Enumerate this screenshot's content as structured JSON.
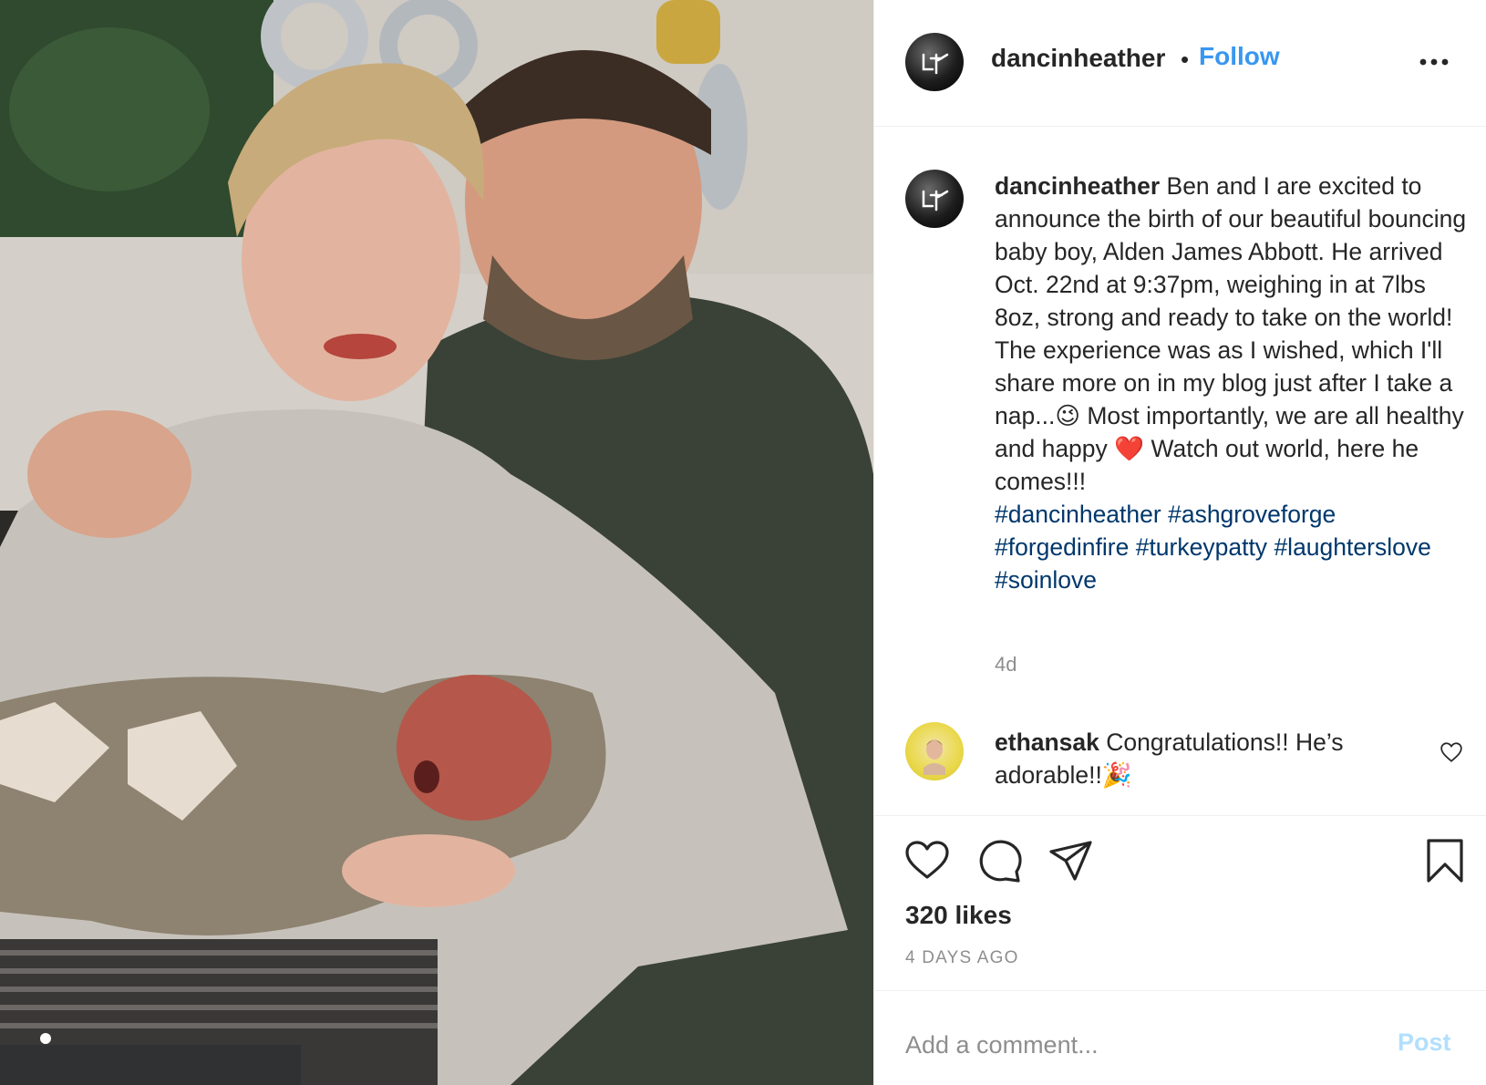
{
  "photo": {
    "description_icon": "family-photo"
  },
  "header": {
    "username": "dancinheather",
    "bullet": "•",
    "follow_label": "Follow",
    "more_icon": "more-horizontal-icon"
  },
  "caption": {
    "username": "dancinheather",
    "text": "Ben and I are excited to announce the birth of our beautiful bouncing baby boy, Alden James Abbott. He arrived Oct. 22nd at 9:37pm, weighing in at 7lbs 8oz, strong and ready to take on the world! The experience was as I wished, which I'll share more on in my blog just after I take a nap...",
    "emoji_wink": "😉",
    "text2": " Most importantly, we are all healthy and happy ",
    "emoji_heart": "❤️",
    "text3": " Watch out world, here he comes!!!",
    "hashtags": [
      "#dancinheather",
      "#ashgroveforge",
      "#forgedinfire",
      "#turkeypatty",
      "#laughterslove",
      "#soinlove"
    ],
    "time": "4d"
  },
  "comment": {
    "username": "ethansak",
    "text": "Congratulations!! He’s adorable!!",
    "emoji": "🎉"
  },
  "actions": {
    "like_icon": "heart-icon",
    "comment_icon": "comment-icon",
    "share_icon": "paper-plane-icon",
    "save_icon": "bookmark-icon"
  },
  "likes": "320 likes",
  "posted_ago": "4 DAYS AGO",
  "add_comment": {
    "placeholder": "Add a comment...",
    "post_label": "Post"
  },
  "colors": {
    "follow": "#3897f0",
    "hashtag": "#00376b",
    "muted": "#8e8e8e",
    "post_disabled": "#b2dffc"
  }
}
